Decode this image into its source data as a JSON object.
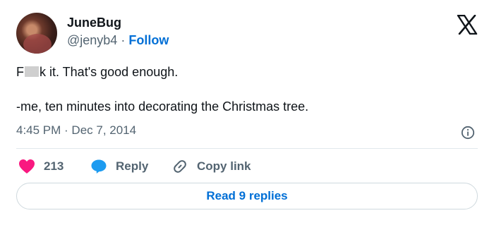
{
  "user": {
    "name": "JuneBug",
    "handle": "@jenyb4",
    "separator": " · ",
    "follow_label": "Follow"
  },
  "tweet": {
    "line1_pre": "F",
    "line1_post": "k it. That's good enough.",
    "line2": "-me, ten minutes into decorating the Christmas tree.",
    "timestamp": "4:45 PM · Dec 7, 2014"
  },
  "actions": {
    "likes_count": "213",
    "reply_label": "Reply",
    "copy_label": "Copy link"
  },
  "read_replies_label": "Read 9 replies",
  "colors": {
    "accent": "#006fd6",
    "heart": "#f91880",
    "reply_bubble": "#1d9bf0",
    "secondary_text": "#536471"
  },
  "icons": [
    "x-logo-icon",
    "info-icon",
    "heart-icon",
    "reply-bubble-icon",
    "link-icon"
  ]
}
